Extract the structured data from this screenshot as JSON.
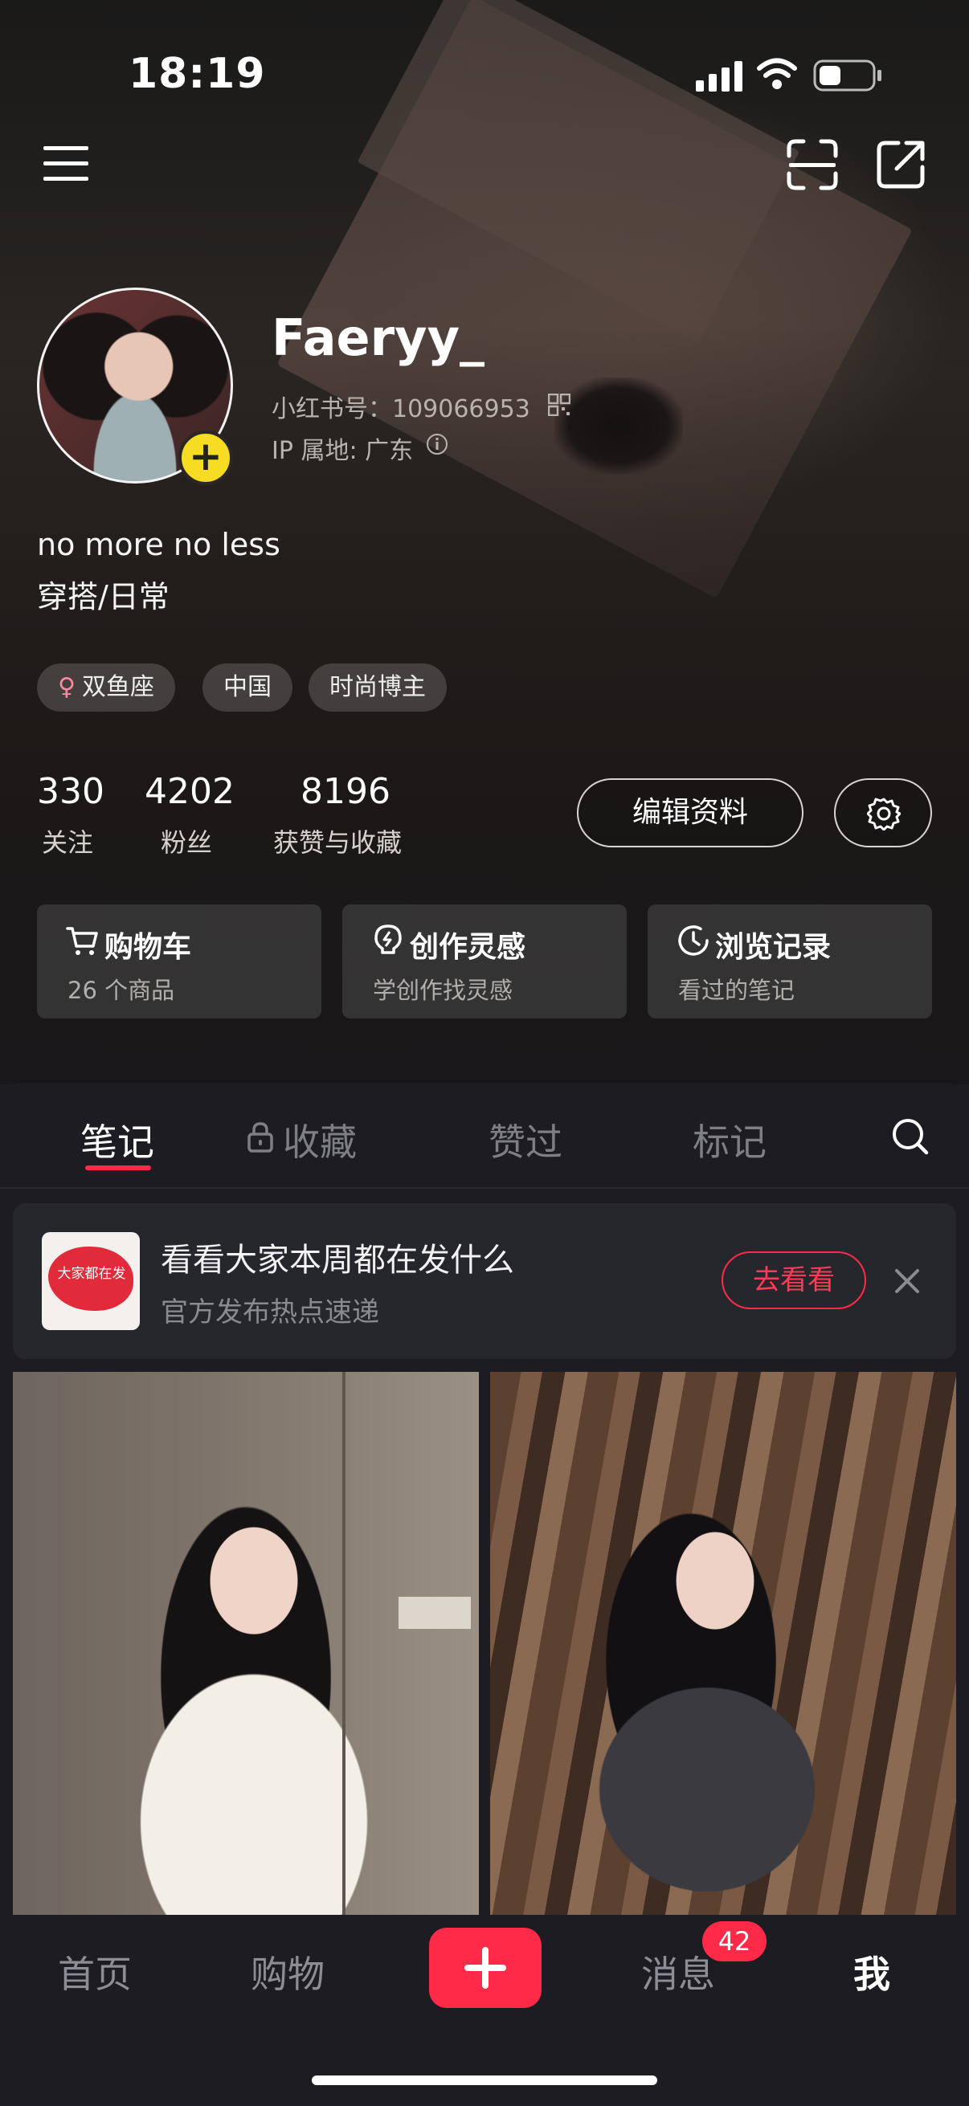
{
  "status_bar": {
    "time": "18:19"
  },
  "profile": {
    "username": "Faeryy_",
    "red_id": "小红书号：109066953",
    "ip_location": "IP 属地: 广东",
    "bio_line1": "no more no less",
    "bio_line2": "穿搭/日常",
    "tags": [
      "双鱼座",
      "中国",
      "时尚博主"
    ]
  },
  "stats": [
    {
      "value": "330",
      "label": "关注"
    },
    {
      "value": "4202",
      "label": "粉丝"
    },
    {
      "value": "8196",
      "label": "获赞与收藏"
    }
  ],
  "buttons": {
    "edit_profile": "编辑资料"
  },
  "cards": [
    {
      "title": "购物车",
      "subtitle": "26 个商品",
      "icon": "cart-icon"
    },
    {
      "title": "创作灵感",
      "subtitle": "学创作找灵感",
      "icon": "lightbulb-icon"
    },
    {
      "title": "浏览记录",
      "subtitle": "看过的笔记",
      "icon": "clock-icon"
    }
  ],
  "tabs": [
    "笔记",
    "收藏",
    "赞过",
    "标记"
  ],
  "banner": {
    "title": "看看大家本周都在发什么",
    "subtitle": "官方发布热点速递",
    "button": "去看看",
    "thumb_text": "大家都在发"
  },
  "bottom_nav": {
    "home": "首页",
    "shop": "购物",
    "messages": "消息",
    "me": "我",
    "messages_badge": "42"
  },
  "colors": {
    "accent": "#ff2a47",
    "avatar_add": "#f7dc24",
    "panel_bg": "#1c1c22"
  }
}
